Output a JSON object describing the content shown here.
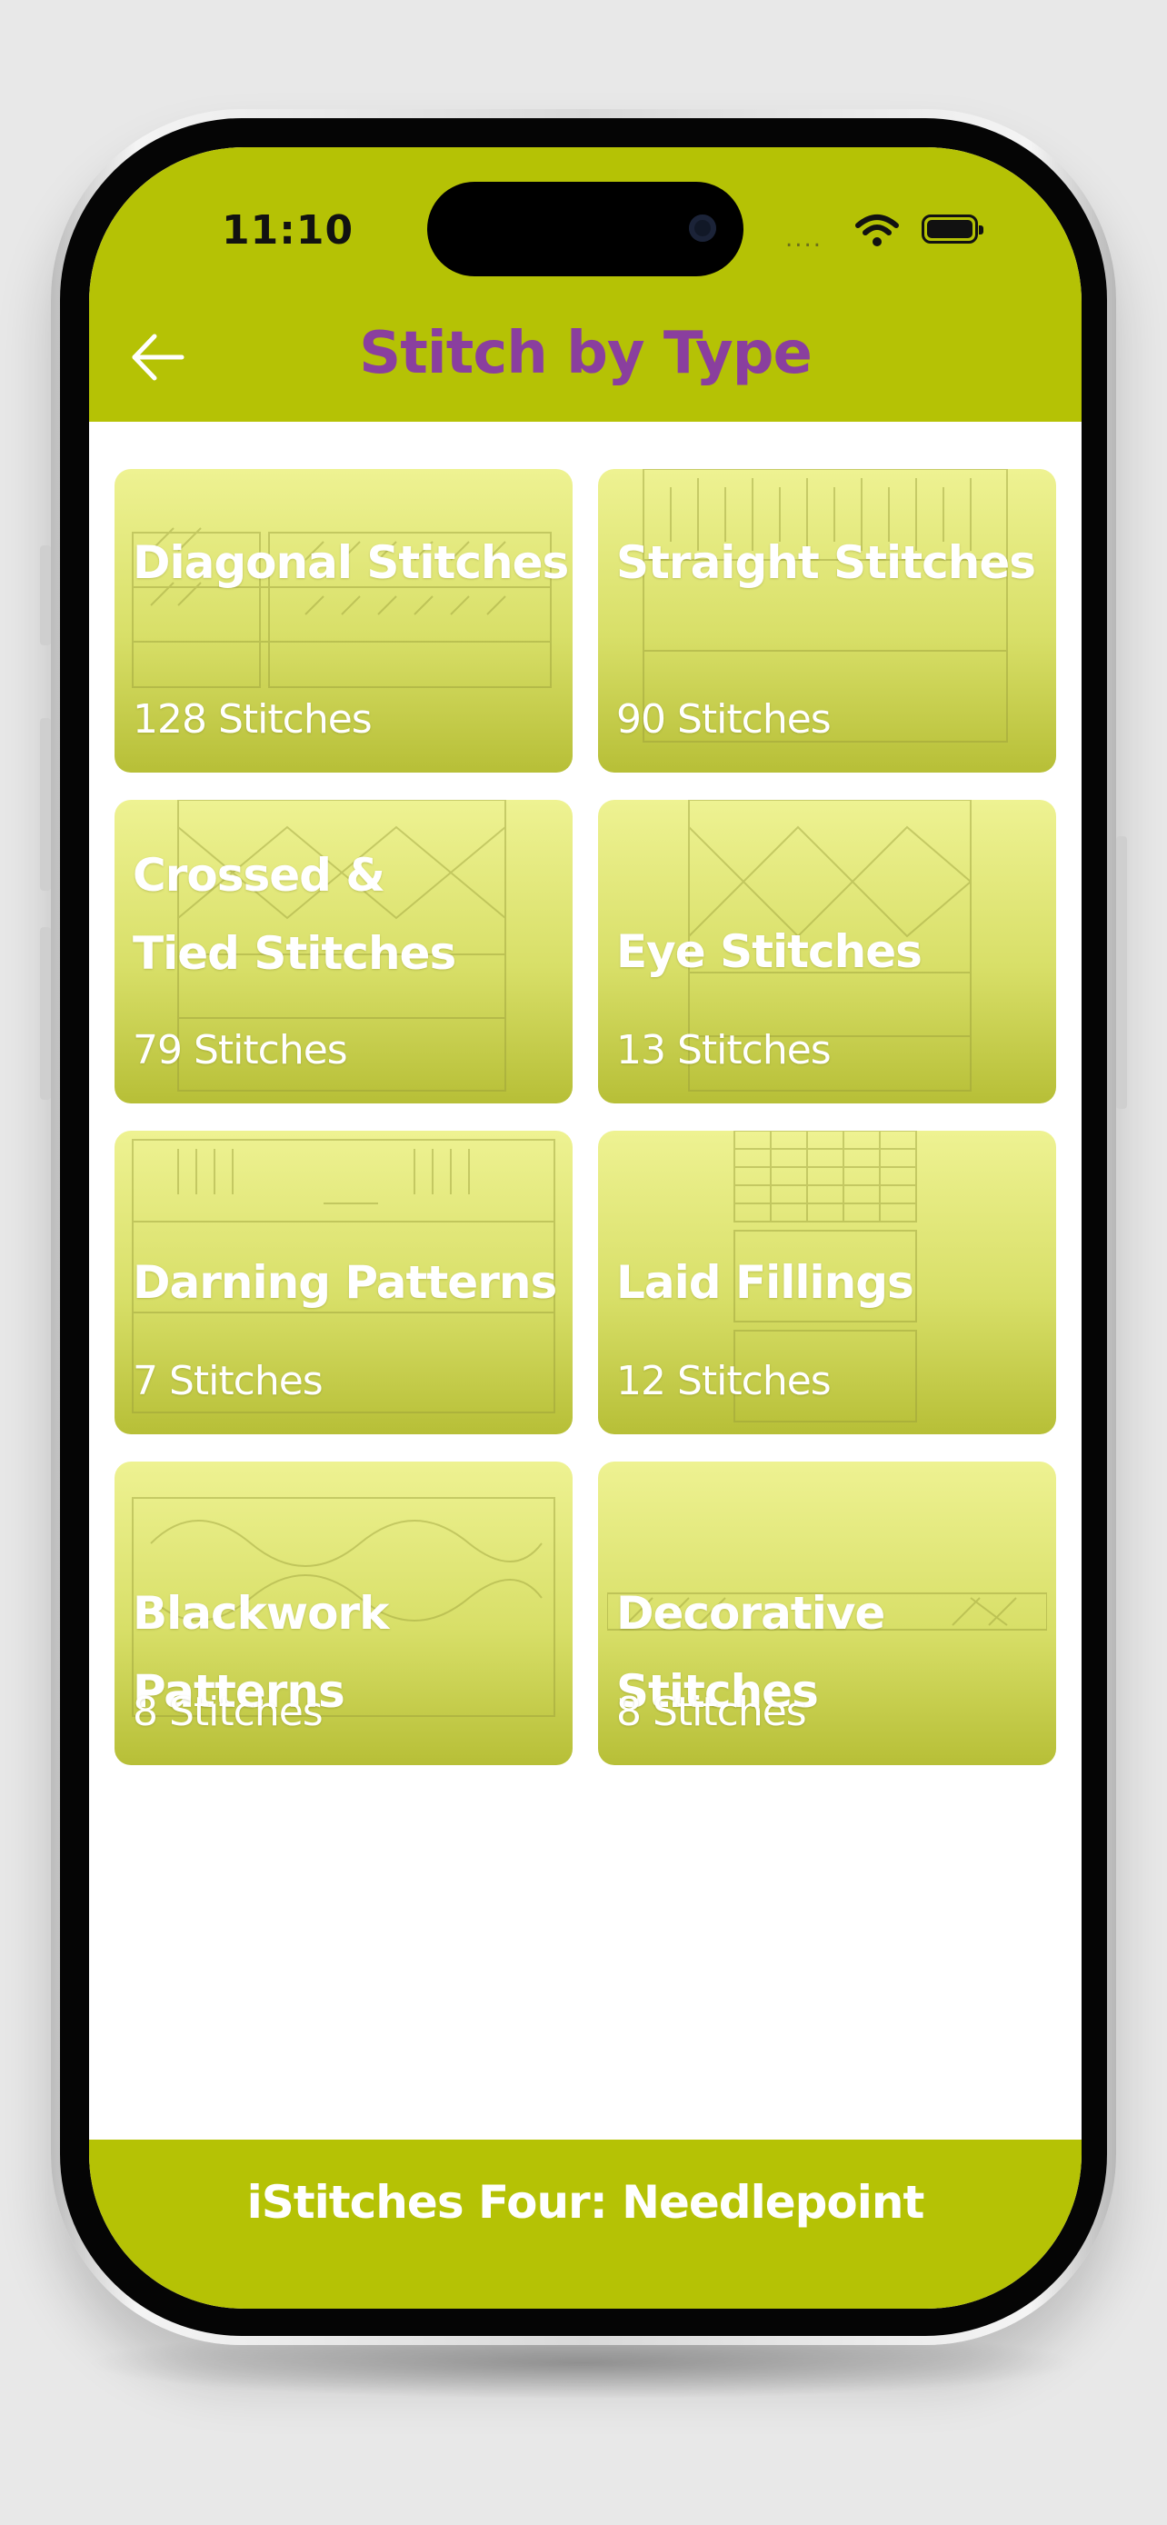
{
  "status_bar": {
    "time": "11:10",
    "signal": "....",
    "wifi_icon": "wifi-icon",
    "battery_icon": "battery-icon"
  },
  "header": {
    "title": "Stitch by Type",
    "back_icon": "arrow-left-icon",
    "background": "#b5c205",
    "title_color": "#8a3f9e"
  },
  "categories": [
    {
      "name": "Diagonal Stitches",
      "count": "128 Stitches"
    },
    {
      "name": "Straight Stitches",
      "count": "90 Stitches"
    },
    {
      "name_line1": "Crossed &",
      "name_line2": "Tied Stitches",
      "count": "79 Stitches"
    },
    {
      "name": "Eye Stitches",
      "count": "13 Stitches"
    },
    {
      "name": "Darning Patterns",
      "count": "7 Stitches"
    },
    {
      "name": "Laid Fillings",
      "count": "12 Stitches"
    },
    {
      "name": "Blackwork Patterns",
      "count": "8 Stitches"
    },
    {
      "name": "Decorative Stitches",
      "count": "8 Stitches"
    }
  ],
  "footer": {
    "text": "iStitches Four: Needlepoint"
  }
}
